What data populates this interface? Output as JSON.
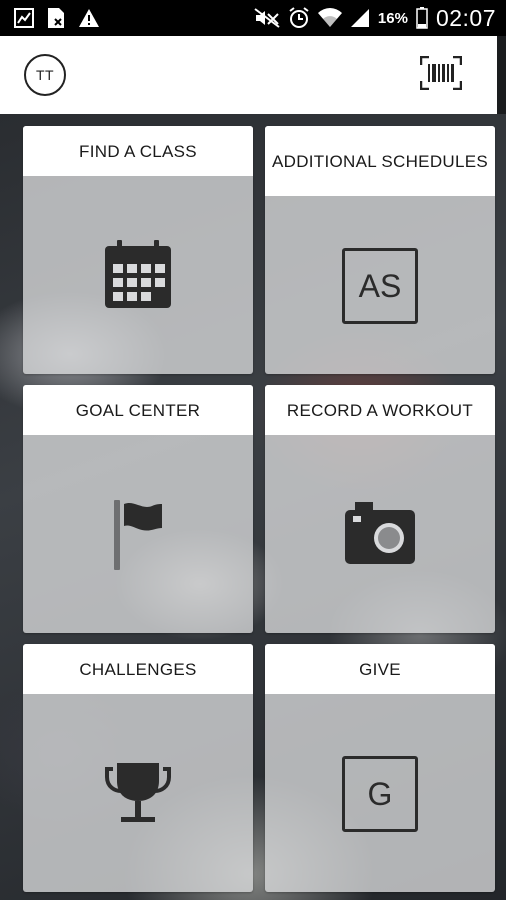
{
  "status_bar": {
    "battery_percent": "16%",
    "time": "02:07",
    "icons_left": [
      "chart-notification-icon",
      "document-notification-icon",
      "warning-icon"
    ],
    "icons_right": [
      "mute-icon",
      "alarm-icon",
      "wifi-icon",
      "signal-icon",
      "battery-icon"
    ]
  },
  "header": {
    "avatar_initials": "TT",
    "barcode_icon": "barcode-scan-icon"
  },
  "tiles": [
    {
      "label": "FIND A CLASS",
      "icon": "calendar-icon"
    },
    {
      "label": "ADDITIONAL SCHEDULES",
      "icon": "schedule-letters-icon",
      "icon_text": "AS"
    },
    {
      "label": "GOAL CENTER",
      "icon": "flag-icon"
    },
    {
      "label": "RECORD A WORKOUT",
      "icon": "camera-icon"
    },
    {
      "label": "CHALLENGES",
      "icon": "trophy-icon"
    },
    {
      "label": "GIVE",
      "icon": "give-letter-icon",
      "icon_text": "G"
    }
  ],
  "colors": {
    "status_bar": "#000000",
    "header": "#ffffff",
    "tile_header": "#ffffff",
    "icon": "#2b2b2b"
  }
}
